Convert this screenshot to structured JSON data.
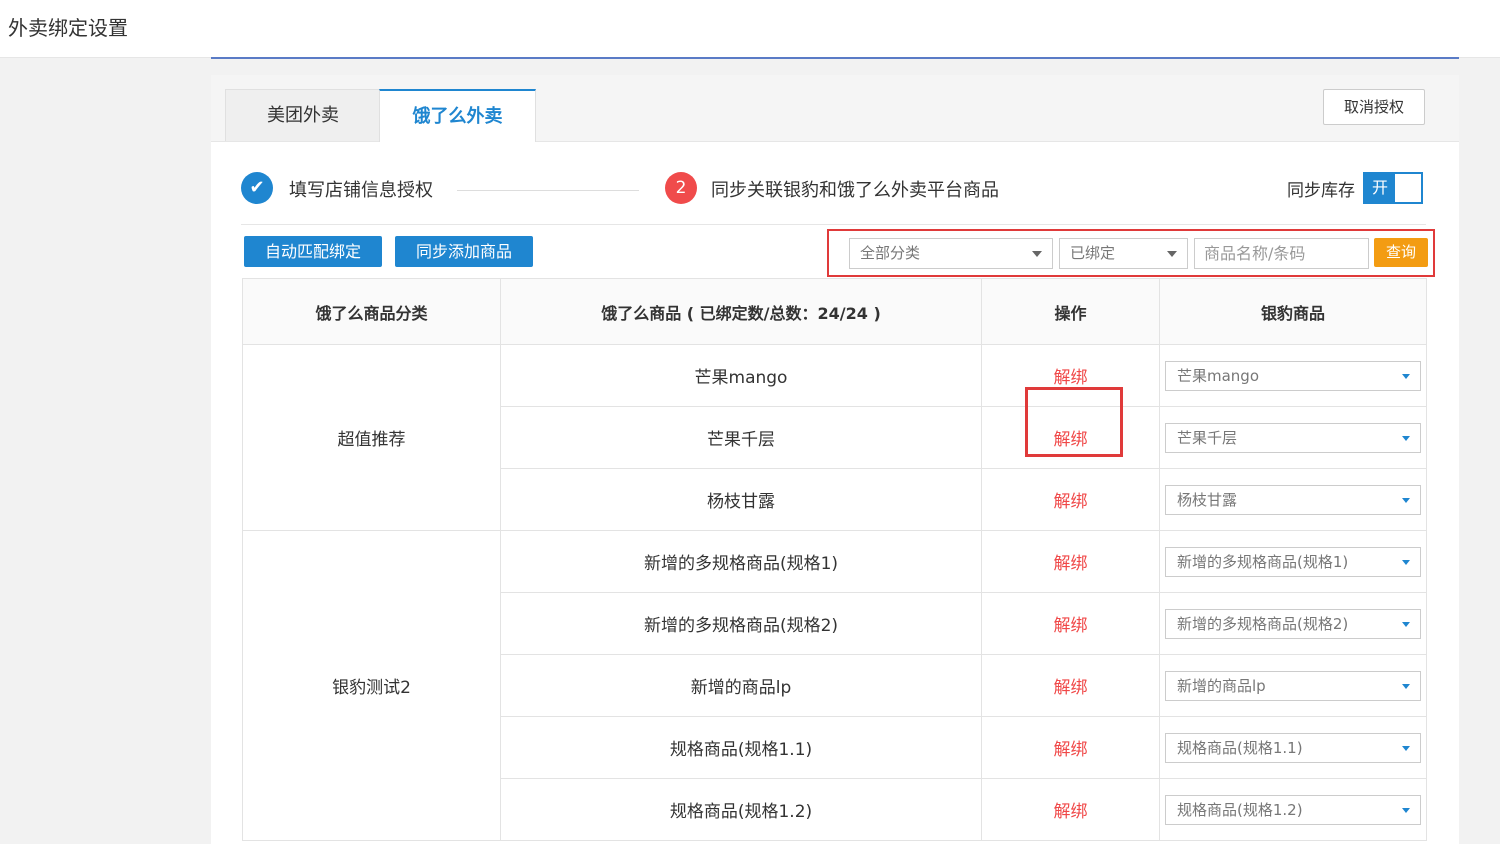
{
  "page": {
    "title": "外卖绑定设置"
  },
  "tabs": [
    {
      "label": "美团外卖",
      "active": false
    },
    {
      "label": "饿了么外卖",
      "active": true
    }
  ],
  "header": {
    "cancel_auth_label": "取消授权"
  },
  "steps": {
    "step1": {
      "icon": "check-icon",
      "label": "填写店铺信息授权"
    },
    "step2": {
      "number": "2",
      "label": "同步关联银豹和饿了么外卖平台商品"
    }
  },
  "sync_stock": {
    "label": "同步库存",
    "state_label": "开"
  },
  "toolbar": {
    "auto_match_label": "自动匹配绑定",
    "sync_add_label": "同步添加商品"
  },
  "filters": {
    "category_value": "全部分类",
    "status_value": "已绑定",
    "search_placeholder": "商品名称/条码",
    "query_label": "查询"
  },
  "table": {
    "headers": [
      "饿了么商品分类",
      "饿了么商品 ( 已绑定数/总数：24/24 )",
      "操作",
      "银豹商品"
    ],
    "groups": [
      {
        "category": "超值推荐",
        "rows": [
          {
            "product": "芒果mango",
            "action": "解绑",
            "bound": "芒果mango"
          },
          {
            "product": "芒果千层",
            "action": "解绑",
            "bound": "芒果千层"
          },
          {
            "product": "杨枝甘露",
            "action": "解绑",
            "bound": "杨枝甘露"
          }
        ]
      },
      {
        "category": "银豹测试2",
        "rows": [
          {
            "product": "新增的多规格商品(规格1)",
            "action": "解绑",
            "bound": "新增的多规格商品(规格1)"
          },
          {
            "product": "新增的多规格商品(规格2)",
            "action": "解绑",
            "bound": "新增的多规格商品(规格2)"
          },
          {
            "product": "新增的商品lp",
            "action": "解绑",
            "bound": "新增的商品lp"
          },
          {
            "product": "规格商品(规格1.1)",
            "action": "解绑",
            "bound": "规格商品(规格1.1)"
          },
          {
            "product": "规格商品(规格1.2)",
            "action": "解绑",
            "bound": "规格商品(规格1.2)"
          }
        ]
      }
    ]
  },
  "colors": {
    "primary": "#1f86d0",
    "danger": "#f04848",
    "warning": "#f39c12",
    "highlight": "#e03a3a"
  }
}
